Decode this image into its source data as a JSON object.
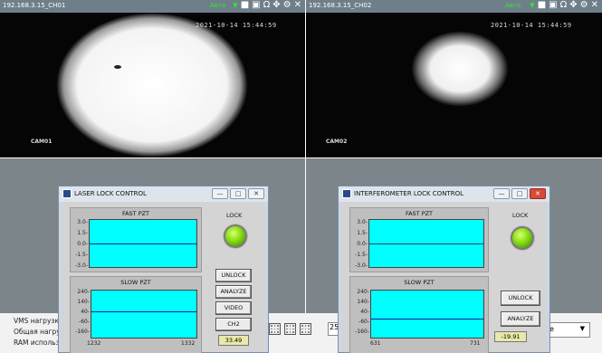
{
  "cam1": {
    "ip_channel": "192.168.3.15_CH01",
    "mode": "Авто",
    "timestamp": "2021-10-14 15:44:59",
    "label": "CAM01"
  },
  "cam2": {
    "ip_channel": "192.168.3.15_CH02",
    "mode": "Авто",
    "timestamp": "2021-10-14 15:44:59",
    "label": "CAM02"
  },
  "cam_toolbar_icons": [
    "dropdown-arrow-icon",
    "record-icon",
    "snapshot-icon",
    "headphones-icon",
    "ptz-icon",
    "settings-icon",
    "close-icon"
  ],
  "status": {
    "line1": "VMS нагрузка",
    "line2": "Общая нагру",
    "line3": "RAM использ",
    "layout_count": "25",
    "dropdown_value": "е"
  },
  "laser_window": {
    "title": "LASER LOCK CONTROL",
    "fast_title": "FAST PZT",
    "fast_yticks": [
      "3.0-",
      "1.5-",
      "0.0-",
      "-1.5-",
      "-3.0-"
    ],
    "slow_title": "SLOW PZT",
    "slow_yticks": [
      "240-",
      "140-",
      "40-",
      "-60-",
      "-160-"
    ],
    "slow_x_start": "1232",
    "slow_x_end": "1332",
    "lock_label": "LOCK",
    "buttons": [
      "UNLOCK",
      "ANALYZE",
      "VIDEO",
      "CH2"
    ],
    "value": "33.49",
    "accent": "#00ffff"
  },
  "interf_window": {
    "title": "INTERFEROMETER LOCK CONTROL",
    "fast_title": "FAST PZT",
    "fast_yticks": [
      "3.0-",
      "1.5-",
      "0.0-",
      "-1.5-",
      "-3.0-"
    ],
    "slow_title": "SLOW PZT",
    "slow_yticks": [
      "240-",
      "140-",
      "40-",
      "-60-",
      "-160-"
    ],
    "slow_x_start": "631",
    "slow_x_end": "731",
    "lock_label": "LOCK",
    "buttons": [
      "UNLOCK",
      "ANALYZE"
    ],
    "value": "-19.91"
  }
}
